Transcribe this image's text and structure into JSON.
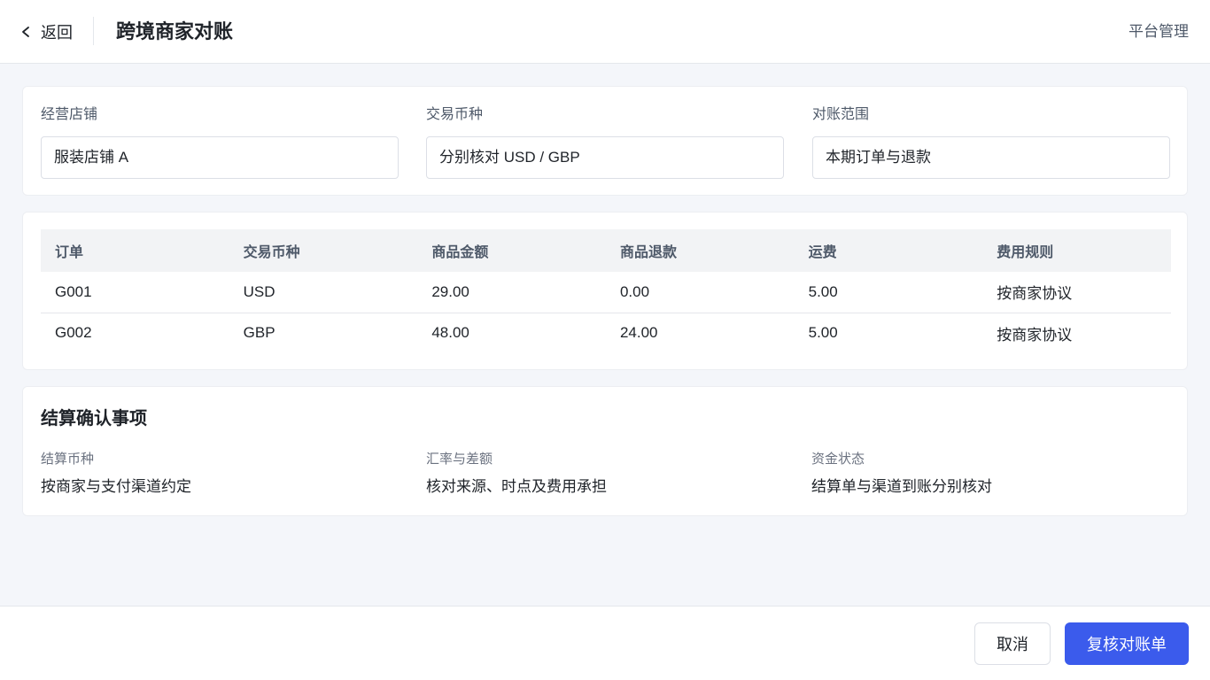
{
  "header": {
    "back_label": "返回",
    "title": "跨境商家对账",
    "platform_label": "平台管理"
  },
  "filters": [
    {
      "label": "经营店铺",
      "value": "服装店铺 A"
    },
    {
      "label": "交易币种",
      "value": "分别核对 USD / GBP"
    },
    {
      "label": "对账范围",
      "value": "本期订单与退款"
    }
  ],
  "table": {
    "headers": [
      "订单",
      "交易币种",
      "商品金额",
      "商品退款",
      "运费",
      "费用规则"
    ],
    "rows": [
      [
        "G001",
        "USD",
        "29.00",
        "0.00",
        "5.00",
        "按商家协议"
      ],
      [
        "G002",
        "GBP",
        "48.00",
        "24.00",
        "5.00",
        "按商家协议"
      ]
    ]
  },
  "settlement": {
    "title": "结算确认事项",
    "items": [
      {
        "label": "结算币种",
        "value": "按商家与支付渠道约定"
      },
      {
        "label": "汇率与差额",
        "value": "核对来源、时点及费用承担"
      },
      {
        "label": "资金状态",
        "value": "结算单与渠道到账分别核对"
      }
    ]
  },
  "footer": {
    "cancel_label": "取消",
    "primary_label": "复核对账单"
  },
  "colors": {
    "primary": "#3b5bec",
    "background": "#f4f6fa",
    "table_header_bg": "#f2f3f5"
  },
  "icons": {
    "back": "chevron-left-icon"
  }
}
